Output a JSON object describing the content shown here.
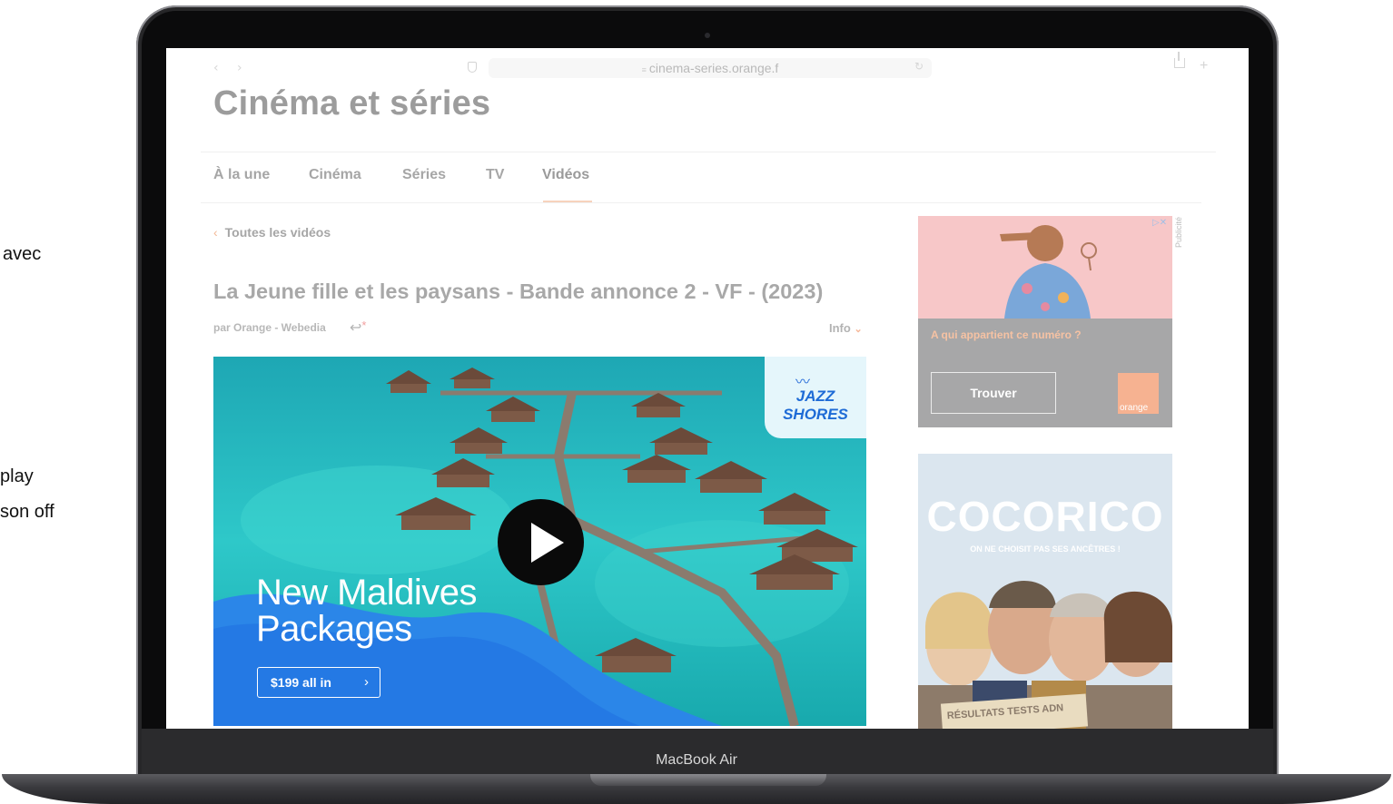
{
  "side_text": {
    "line1": "avec",
    "line2": "play",
    "line3": "son off"
  },
  "device": {
    "label": "MacBook Air"
  },
  "browser": {
    "back_glyph": "‹",
    "forward_glyph": "›",
    "url": "cinema-series.orange.f",
    "url_prefix": "≡",
    "reload_glyph": "↻",
    "new_tab_glyph": "+"
  },
  "site": {
    "title": "Cinéma et séries"
  },
  "nav": {
    "tabs": [
      {
        "label": "À la une"
      },
      {
        "label": "Cinéma"
      },
      {
        "label": "Séries"
      },
      {
        "label": "TV"
      },
      {
        "label": "Vidéos"
      }
    ],
    "active": "Vidéos"
  },
  "article": {
    "back_chev": "‹",
    "back_label": "Toutes les vidéos",
    "title": "La Jeune fille et les paysans - Bande annonce 2 - VF - (2023)",
    "byline": "par Orange - Webedia",
    "byline_icon": "↩",
    "byline_star": "*",
    "info_label": "Info",
    "info_chev": "⌄"
  },
  "video_ad": {
    "brand_wave": "〰",
    "brand_line1": "JAZZ",
    "brand_line2": "SHORES",
    "headline_line1": "New Maldives",
    "headline_line2": "Packages",
    "cta_label": "$199 all in",
    "cta_arrow": "›"
  },
  "ad_top": {
    "question": "A qui appartient ce numéro ?",
    "button": "Trouver",
    "logo": "orange",
    "publicite": "Publicité",
    "adchoices": "▷✕"
  },
  "ad_bottom": {
    "title": "COCORICO",
    "subtitle": "ON NE CHOISIT PAS SES ANCÊTRES !",
    "banner": "RÉSULTATS TESTS ADN"
  }
}
